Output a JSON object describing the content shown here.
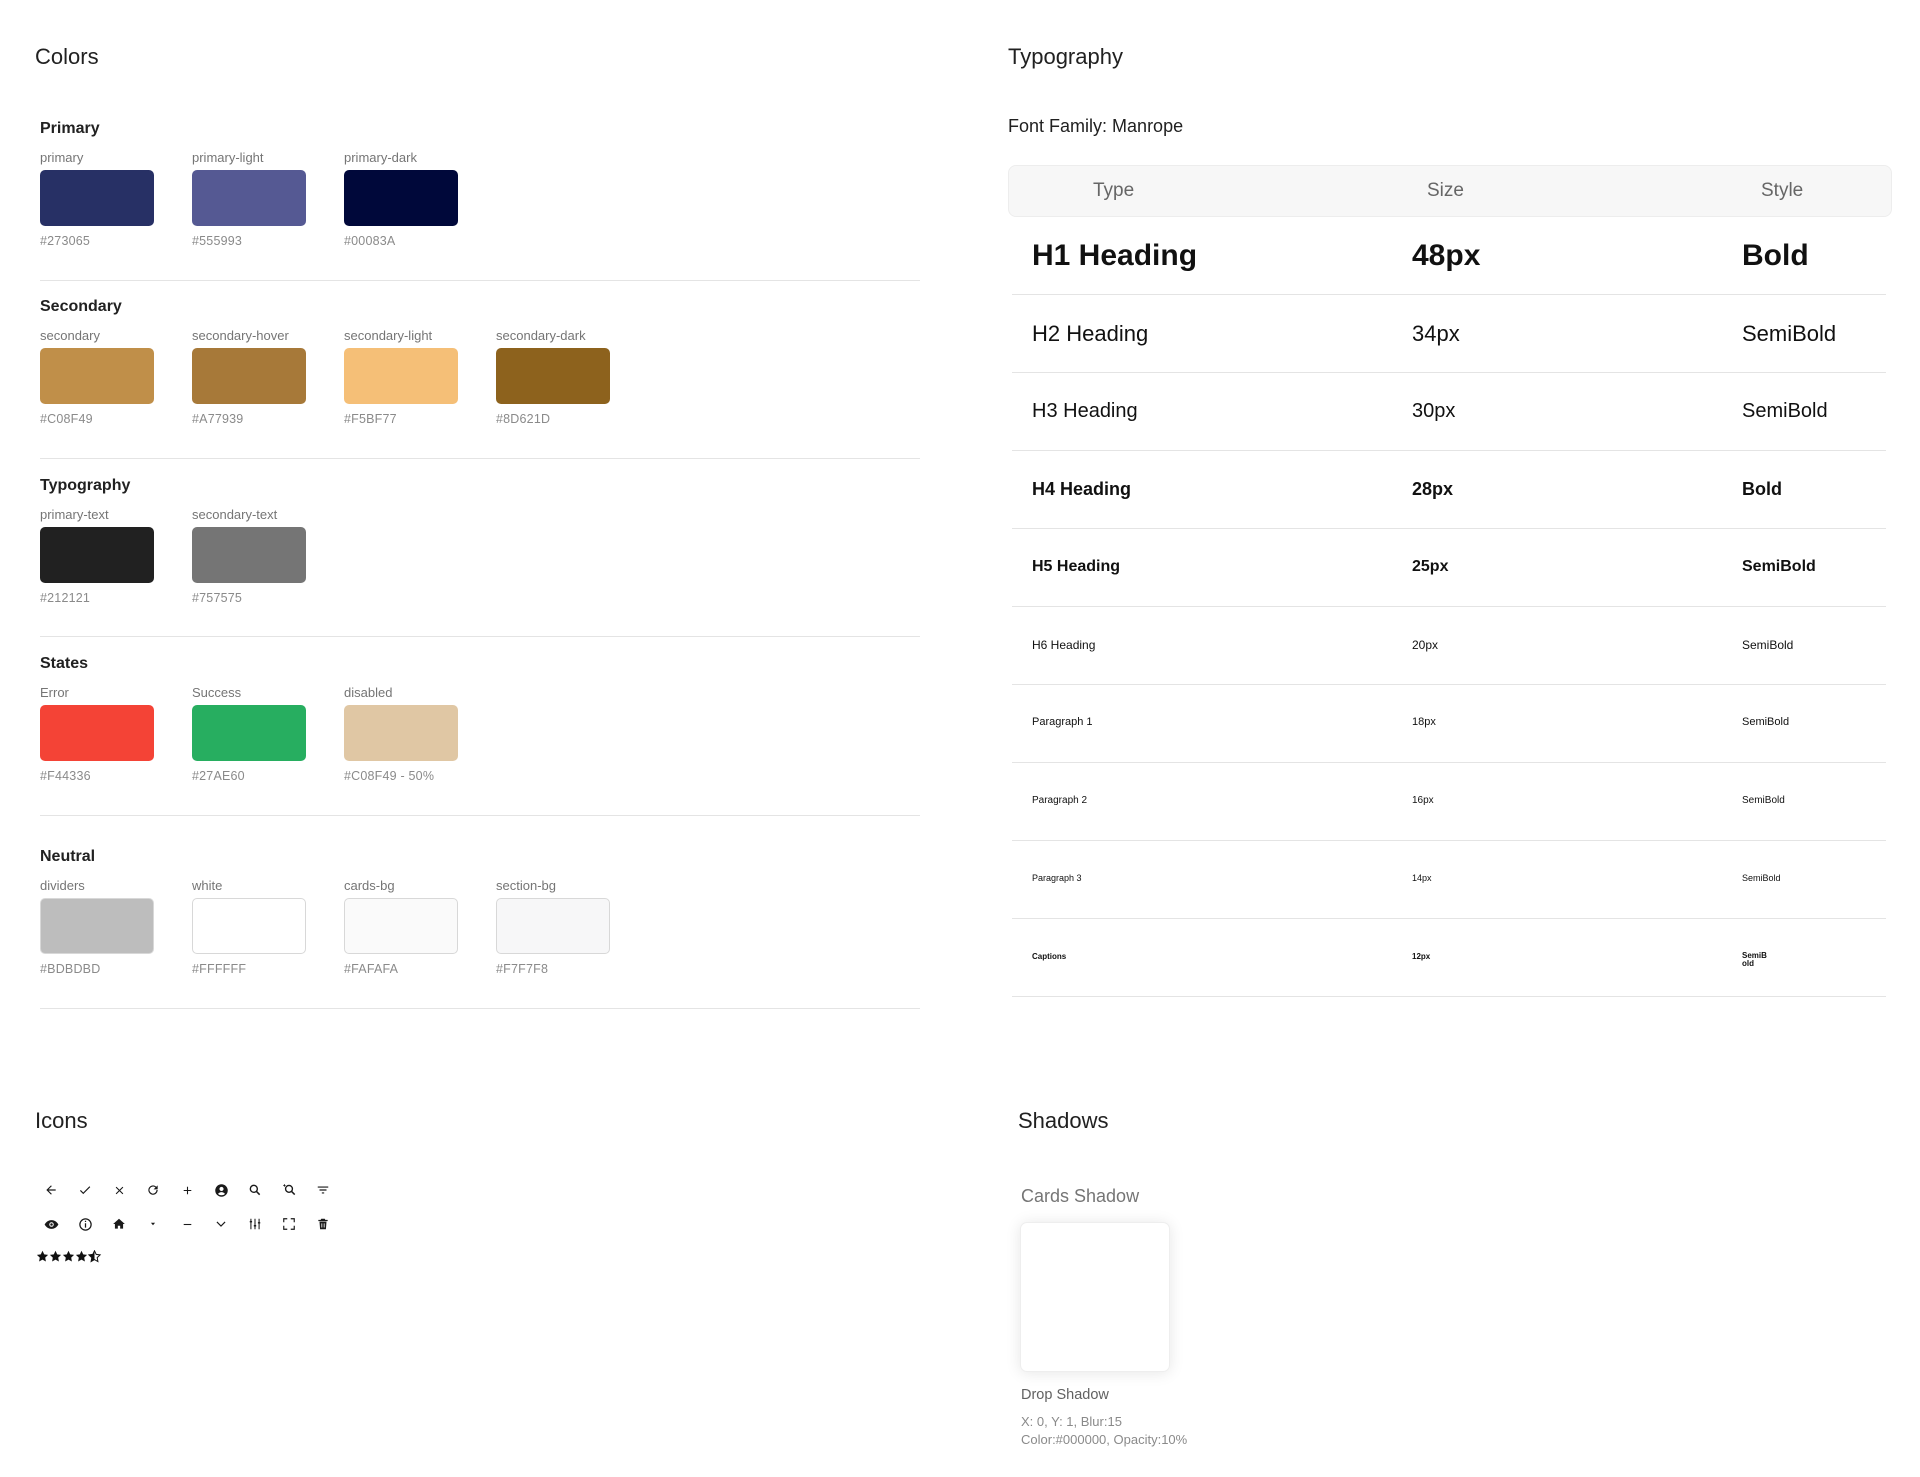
{
  "colors": {
    "title": "Colors",
    "groups": [
      {
        "title": "Primary",
        "swatches": [
          {
            "name": "primary",
            "hex_label": "#273065",
            "color": "#273065"
          },
          {
            "name": "primary-light",
            "hex_label": "#555993",
            "color": "#555993"
          },
          {
            "name": "primary-dark",
            "hex_label": "#00083A",
            "color": "#00083A"
          }
        ]
      },
      {
        "title": "Secondary",
        "swatches": [
          {
            "name": "secondary",
            "hex_label": "#C08F49",
            "color": "#C08F49"
          },
          {
            "name": "secondary-hover",
            "hex_label": "#A77939",
            "color": "#A77939"
          },
          {
            "name": "secondary-light",
            "hex_label": "#F5BF77",
            "color": "#F5BF77"
          },
          {
            "name": "secondary-dark",
            "hex_label": "#8D621D",
            "color": "#8D621D"
          }
        ]
      },
      {
        "title": "Typography",
        "swatches": [
          {
            "name": "primary-text",
            "hex_label": "#212121",
            "color": "#212121"
          },
          {
            "name": "secondary-text",
            "hex_label": "#757575",
            "color": "#757575"
          }
        ]
      },
      {
        "title": "States",
        "swatches": [
          {
            "name": "Error",
            "hex_label": "#F44336",
            "color": "#F44336"
          },
          {
            "name": "Success",
            "hex_label": "#27AE60",
            "color": "#27AE60"
          },
          {
            "name": "disabled",
            "hex_label": "#C08F49 - 50%",
            "color": "#E0C7A4"
          }
        ]
      },
      {
        "title": "Neutral",
        "swatches": [
          {
            "name": "dividers",
            "hex_label": "#BDBDBD",
            "color": "#BDBDBD"
          },
          {
            "name": "white",
            "hex_label": "#FFFFFF",
            "color": "#FFFFFF"
          },
          {
            "name": "cards-bg",
            "hex_label": "#FAFAFA",
            "color": "#FAFAFA"
          },
          {
            "name": "section-bg",
            "hex_label": "#F7F7F8",
            "color": "#F7F7F8"
          }
        ]
      }
    ]
  },
  "typography": {
    "title": "Typography",
    "font_family_label": "Font Family:",
    "font_family_value": "Manrope",
    "headers": {
      "type": "Type",
      "size": "Size",
      "style": "Style"
    },
    "rows": [
      {
        "type": "H1 Heading",
        "size": "48px",
        "style": "Bold"
      },
      {
        "type": "H2 Heading",
        "size": "34px",
        "style": "SemiBold"
      },
      {
        "type": "H3 Heading",
        "size": "30px",
        "style": "SemiBold"
      },
      {
        "type": "H4 Heading",
        "size": "28px",
        "style": "Bold"
      },
      {
        "type": "H5 Heading",
        "size": "25px",
        "style": "SemiBold"
      },
      {
        "type": "H6 Heading",
        "size": "20px",
        "style": "SemiBold"
      },
      {
        "type": "Paragraph 1",
        "size": "18px",
        "style": "SemiBold"
      },
      {
        "type": "Paragraph 2",
        "size": "16px",
        "style": "SemiBold"
      },
      {
        "type": "Paragraph 3",
        "size": "14px",
        "style": "SemiBold"
      },
      {
        "type": "Captions",
        "size": "12px",
        "style": "SemiB old"
      }
    ]
  },
  "icons": {
    "title": "Icons",
    "row1": [
      "arrow-back-icon",
      "check-icon",
      "close-icon",
      "refresh-icon",
      "plus-icon",
      "account-circle-icon",
      "search-icon",
      "zoom-in-icon",
      "filter-icon"
    ],
    "row2": [
      "eye-icon",
      "info-icon",
      "home-icon",
      "caret-down-icon",
      "minus-icon",
      "chevron-down-icon",
      "sliders-icon",
      "fullscreen-icon",
      "trash-icon"
    ],
    "rating": 4.5
  },
  "shadows": {
    "title": "Shadows",
    "card_label": "Cards Shadow",
    "shadow_name": "Drop Shadow",
    "shadow_params": "X: 0, Y: 1, Blur:15",
    "shadow_color": "Color:#000000, Opacity:10%"
  }
}
